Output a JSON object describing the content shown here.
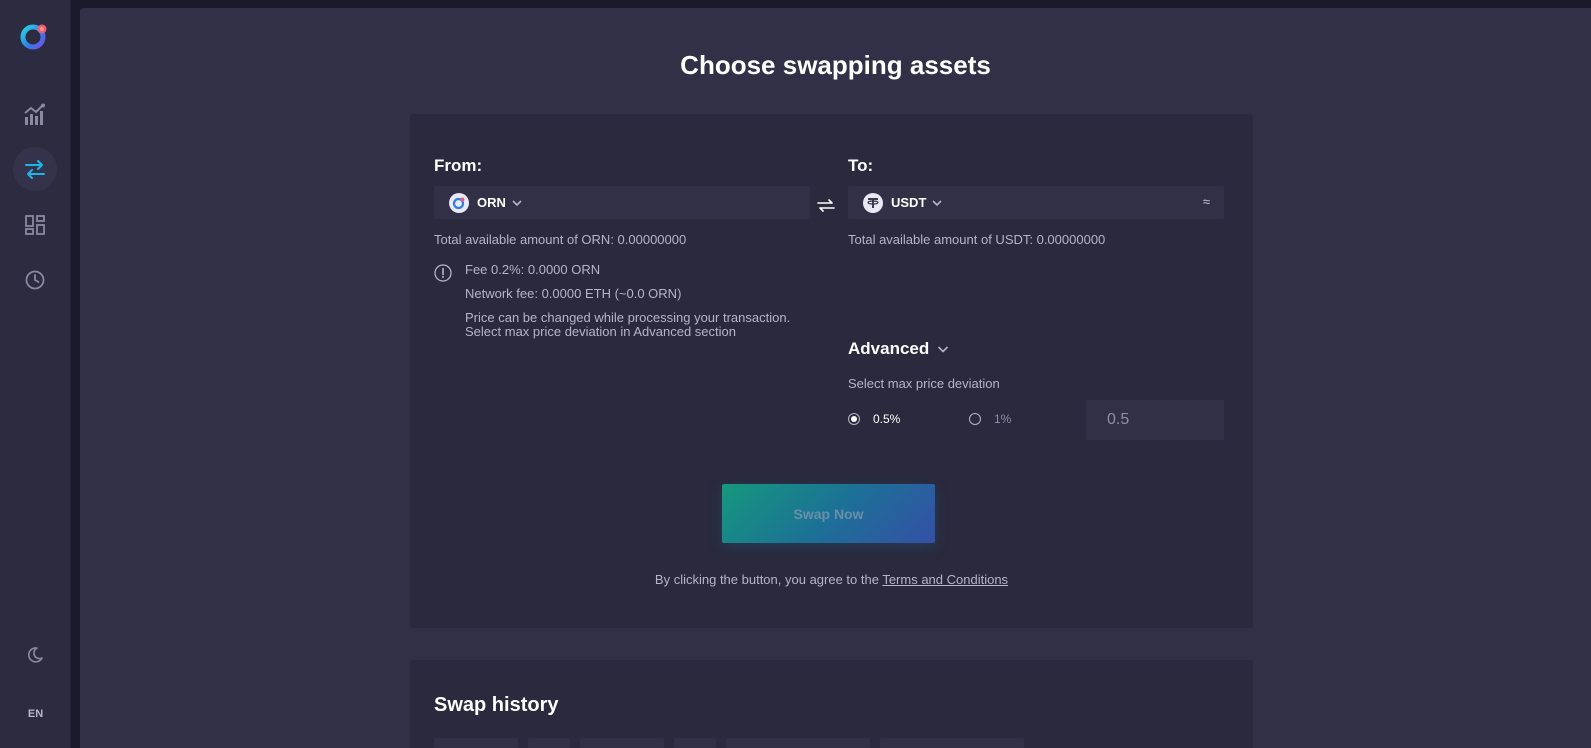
{
  "sidebar": {
    "nav": [
      "chart-icon",
      "swap-icon",
      "dashboard-icon",
      "history-icon"
    ],
    "active": "swap-icon",
    "lang": "EN"
  },
  "page": {
    "title": "Choose swapping assets"
  },
  "swap": {
    "from_label": "From:",
    "to_label": "To:",
    "from_asset": "ORN",
    "to_asset": "USDT",
    "approx_symbol": "≈",
    "from_available": "Total available amount of ORN: 0.00000000",
    "to_available": "Total available amount of USDT: 0.00000000",
    "fee": "Fee 0.2%: 0.0000 ORN",
    "network_fee": "Network fee: 0.0000 ETH (~0.0 ORN)",
    "price_note_1": "Price can be changed while processing your transaction.",
    "price_note_2": "Select max price deviation in Advanced section"
  },
  "advanced": {
    "title": "Advanced",
    "subtitle": "Select max price deviation",
    "option_1": "0.5%",
    "option_2": "1%",
    "selected": "0.5%",
    "custom_value": "0.5"
  },
  "actions": {
    "swap_button": "Swap Now",
    "agree_text": "By clicking the button, you agree to the ",
    "terms_link": "Terms and Conditions"
  },
  "history": {
    "title": "Swap history"
  },
  "colors": {
    "background": "#1b1a2a",
    "sidebar": "#2c2b3f",
    "panel": "#313047",
    "card": "#2a293d",
    "accent_blue": "#1fb5e8",
    "button_gradient_start": "#15987d",
    "button_gradient_end": "#3550a6"
  }
}
